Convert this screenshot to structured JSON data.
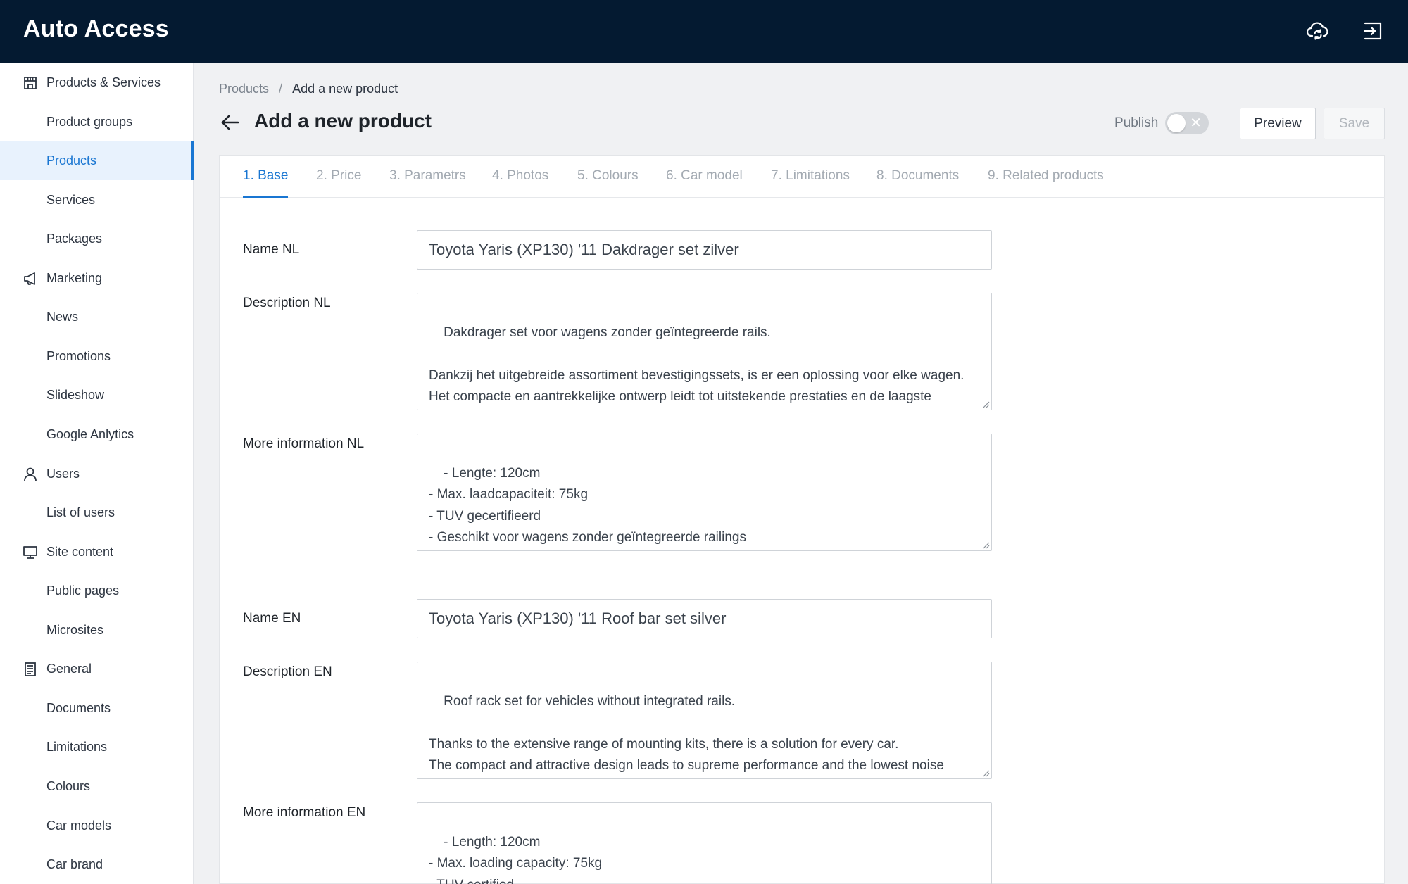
{
  "app": {
    "brand": "Auto Access"
  },
  "topbar": {
    "icons": [
      "cloud-sync-icon",
      "logout-icon"
    ]
  },
  "sidebar": {
    "products_services": "Products & Services",
    "product_groups": "Product groups",
    "products": "Products",
    "services": "Services",
    "packages": "Packages",
    "marketing": "Marketing",
    "news": "News",
    "promotions": "Promotions",
    "slideshow": "Slideshow",
    "google_anlytics": "Google Anlytics",
    "users": "Users",
    "list_of_users": "List of users",
    "site_content": "Site content",
    "public_pages": "Public pages",
    "microsites": "Microsites",
    "general": "General",
    "documents": "Documents",
    "limitations": "Limitations",
    "colours": "Colours",
    "car_models": "Car models",
    "car_brand": "Car brand"
  },
  "breadcrumb": {
    "root": "Products",
    "separator": "/",
    "current": "Add a new product"
  },
  "header": {
    "title": "Add a new product",
    "publish_label": "Publish",
    "publish_on": false,
    "preview_label": "Preview",
    "save_label": "Save"
  },
  "tabs": {
    "base": "1. Base",
    "price": "2. Price",
    "parametrs": "3. Parametrs",
    "photos": "4. Photos",
    "colours": "5. Colours",
    "car_model": "6. Car model",
    "limitations": "7. Limitations",
    "documents": "8. Documents",
    "related_products": "9. Related products"
  },
  "form": {
    "name_nl_label": "Name NL",
    "name_nl_value": "Toyota Yaris (XP130) '11 Dakdrager set zilver",
    "description_nl_label": "Description NL",
    "description_nl_value": "Dakdrager set voor wagens zonder geïntegreerde rails.\n\nDankzij het uitgebreide assortiment bevestigingssets, is er een oplossing voor elke wagen.\nHet compacte en aantrekkelijke ontwerp leidt tot uitstekende prestaties en de laagste\ngeluidsemissies.",
    "more_info_nl_label": "More information NL",
    "more_info_nl_value": "- Lengte: 120cm\n- Max. laadcapaciteit: 75kg\n- TUV gecertifieerd\n- Geschikt voor wagens zonder geïntegreerde railings\n- Aluminium",
    "name_en_label": "Name EN",
    "name_en_value": "Toyota Yaris (XP130) '11 Roof bar set silver",
    "description_en_label": "Description EN",
    "description_en_value": "Roof rack set for vehicles without integrated rails.\n\nThanks to the extensive range of mounting kits, there is a solution for every car.\nThe compact and attractive design leads to supreme performance and the lowest noise\nemissions.",
    "more_info_en_label": "More information EN",
    "more_info_en_value": "- Length: 120cm\n- Max. loading capacity: 75kg\n- TUV certified\n- Suitable for vehicles with integrated railings"
  },
  "colors": {
    "topbar": "#041a31",
    "accent": "#1976d2",
    "active_bg": "#e8f2fd"
  }
}
